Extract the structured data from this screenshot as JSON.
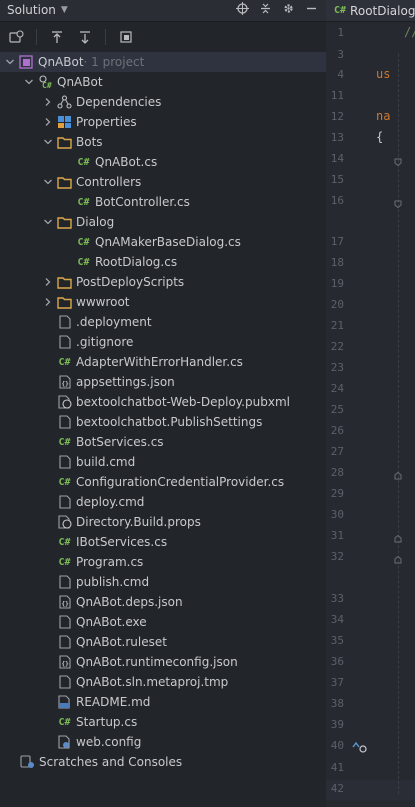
{
  "sidebar": {
    "title": "Solution",
    "tree": [
      {
        "label": "QnABot",
        "suffix": " · 1 project",
        "depth": 0,
        "icon": "solution-icon",
        "arrow": "down",
        "selected": true
      },
      {
        "label": "QnABot",
        "depth": 1,
        "icon": "csharp-project-icon",
        "arrow": "down"
      },
      {
        "label": "Dependencies",
        "depth": 2,
        "icon": "dependencies-icon",
        "arrow": "right"
      },
      {
        "label": "Properties",
        "depth": 2,
        "icon": "properties-icon",
        "arrow": "right"
      },
      {
        "label": "Bots",
        "depth": 2,
        "icon": "folder-icon",
        "arrow": "down"
      },
      {
        "label": "QnABot.cs",
        "depth": 3,
        "icon": "csharp-file-icon",
        "arrow": "none"
      },
      {
        "label": "Controllers",
        "depth": 2,
        "icon": "folder-icon",
        "arrow": "down"
      },
      {
        "label": "BotController.cs",
        "depth": 3,
        "icon": "csharp-file-icon",
        "arrow": "none"
      },
      {
        "label": "Dialog",
        "depth": 2,
        "icon": "folder-icon",
        "arrow": "down"
      },
      {
        "label": "QnAMakerBaseDialog.cs",
        "depth": 3,
        "icon": "csharp-file-icon",
        "arrow": "none"
      },
      {
        "label": "RootDialog.cs",
        "depth": 3,
        "icon": "csharp-file-icon",
        "arrow": "none"
      },
      {
        "label": "PostDeployScripts",
        "depth": 2,
        "icon": "folder-icon",
        "arrow": "right"
      },
      {
        "label": "wwwroot",
        "depth": 2,
        "icon": "folder-icon",
        "arrow": "right"
      },
      {
        "label": ".deployment",
        "depth": 2,
        "icon": "file-icon",
        "arrow": "none"
      },
      {
        "label": ".gitignore",
        "depth": 2,
        "icon": "file-icon",
        "arrow": "none"
      },
      {
        "label": "AdapterWithErrorHandler.cs",
        "depth": 2,
        "icon": "csharp-file-icon",
        "arrow": "none"
      },
      {
        "label": "appsettings.json",
        "depth": 2,
        "icon": "json-file-icon",
        "arrow": "none"
      },
      {
        "label": "bextoolchatbot-Web-Deploy.pubxml",
        "depth": 2,
        "icon": "publish-file-icon",
        "arrow": "none"
      },
      {
        "label": "bextoolchatbot.PublishSettings",
        "depth": 2,
        "icon": "file-icon",
        "arrow": "none"
      },
      {
        "label": "BotServices.cs",
        "depth": 2,
        "icon": "csharp-file-icon",
        "arrow": "none"
      },
      {
        "label": "build.cmd",
        "depth": 2,
        "icon": "file-icon",
        "arrow": "none"
      },
      {
        "label": "ConfigurationCredentialProvider.cs",
        "depth": 2,
        "icon": "csharp-file-icon",
        "arrow": "none"
      },
      {
        "label": "deploy.cmd",
        "depth": 2,
        "icon": "file-icon",
        "arrow": "none"
      },
      {
        "label": "Directory.Build.props",
        "depth": 2,
        "icon": "xml-file-icon",
        "arrow": "none"
      },
      {
        "label": "IBotServices.cs",
        "depth": 2,
        "icon": "csharp-file-icon",
        "arrow": "none"
      },
      {
        "label": "Program.cs",
        "depth": 2,
        "icon": "csharp-file-icon",
        "arrow": "none"
      },
      {
        "label": "publish.cmd",
        "depth": 2,
        "icon": "file-icon",
        "arrow": "none"
      },
      {
        "label": "QnABot.deps.json",
        "depth": 2,
        "icon": "json-file-icon",
        "arrow": "none"
      },
      {
        "label": "QnABot.exe",
        "depth": 2,
        "icon": "file-icon",
        "arrow": "none"
      },
      {
        "label": "QnABot.ruleset",
        "depth": 2,
        "icon": "file-icon",
        "arrow": "none"
      },
      {
        "label": "QnABot.runtimeconfig.json",
        "depth": 2,
        "icon": "json-file-icon",
        "arrow": "none"
      },
      {
        "label": "QnABot.sln.metaproj.tmp",
        "depth": 2,
        "icon": "file-icon",
        "arrow": "none"
      },
      {
        "label": "README.md",
        "depth": 2,
        "icon": "markdown-file-icon",
        "arrow": "none"
      },
      {
        "label": "Startup.cs",
        "depth": 2,
        "icon": "csharp-file-icon",
        "arrow": "none"
      },
      {
        "label": "web.config",
        "depth": 2,
        "icon": "config-file-icon",
        "arrow": "none"
      }
    ],
    "scratches": "Scratches and Consoles"
  },
  "editor": {
    "tab_label": "RootDialog.cs",
    "line_numbers": [
      "1",
      "3",
      "4",
      "11",
      "12",
      "13",
      "14",
      "15",
      "16",
      "17",
      "18",
      "19",
      "20",
      "21",
      "22",
      "23",
      "24",
      "25",
      "26",
      "27",
      "28",
      "29",
      "30",
      "31",
      "32",
      "33",
      "34",
      "35",
      "36",
      "37",
      "38",
      "39",
      "40",
      "41",
      "42"
    ],
    "code_snippets": [
      {
        "line": "1",
        "text": "//"
      },
      {
        "line": "4",
        "text": "us"
      },
      {
        "line": "12",
        "text": "na"
      },
      {
        "line": "13",
        "text": "{"
      }
    ]
  },
  "colors": {
    "folder": "#d9a74a",
    "csharp": "#7dbb57",
    "keyword": "#cc7832"
  }
}
